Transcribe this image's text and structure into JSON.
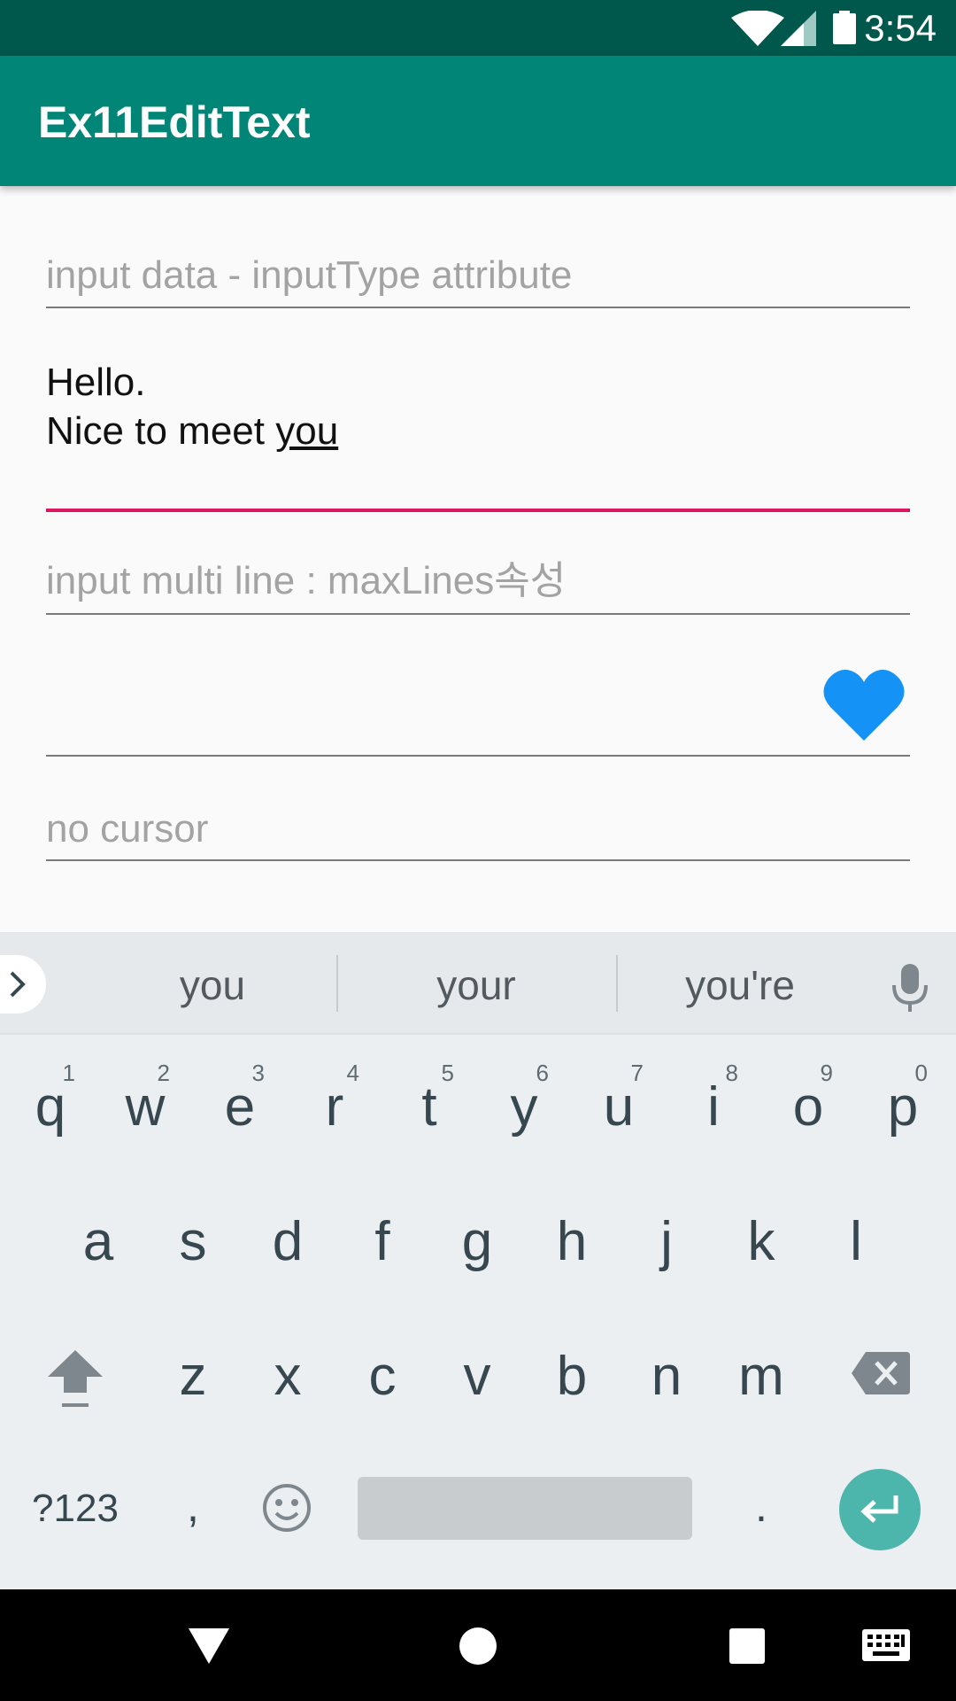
{
  "status_bar": {
    "time": "3:54",
    "icons": [
      "wifi-icon",
      "signal-icon",
      "battery-icon"
    ]
  },
  "app_bar": {
    "title": "Ex11EditText",
    "color": "#008577"
  },
  "fields": {
    "input_type_hint": "input data - inputType attribute",
    "multiline_text_line1": "Hello.",
    "multiline_text_line2_prefix": "Nice to meet ",
    "multiline_text_line2_underlined": "you",
    "max_lines_hint": "input multi line : maxLines속성",
    "drawable_field_icon": "heart-icon",
    "no_cursor_hint": "no cursor"
  },
  "colors": {
    "focus_underline": "#d81b60",
    "heart": "#1592f5",
    "enter_key": "#4db6ac"
  },
  "keyboard": {
    "suggestions": [
      "you",
      "your",
      "you're"
    ],
    "row1": [
      {
        "key": "q",
        "num": "1"
      },
      {
        "key": "w",
        "num": "2"
      },
      {
        "key": "e",
        "num": "3"
      },
      {
        "key": "r",
        "num": "4"
      },
      {
        "key": "t",
        "num": "5"
      },
      {
        "key": "y",
        "num": "6"
      },
      {
        "key": "u",
        "num": "7"
      },
      {
        "key": "i",
        "num": "8"
      },
      {
        "key": "o",
        "num": "9"
      },
      {
        "key": "p",
        "num": "0"
      }
    ],
    "row2": [
      "a",
      "s",
      "d",
      "f",
      "g",
      "h",
      "j",
      "k",
      "l"
    ],
    "row3": [
      "z",
      "x",
      "c",
      "v",
      "b",
      "n",
      "m"
    ],
    "symbols_label": "?123",
    "comma_label": ",",
    "period_label": "."
  },
  "nav_bar": {
    "icons": [
      "back-icon",
      "home-icon",
      "recents-icon",
      "keyboard-icon"
    ]
  }
}
